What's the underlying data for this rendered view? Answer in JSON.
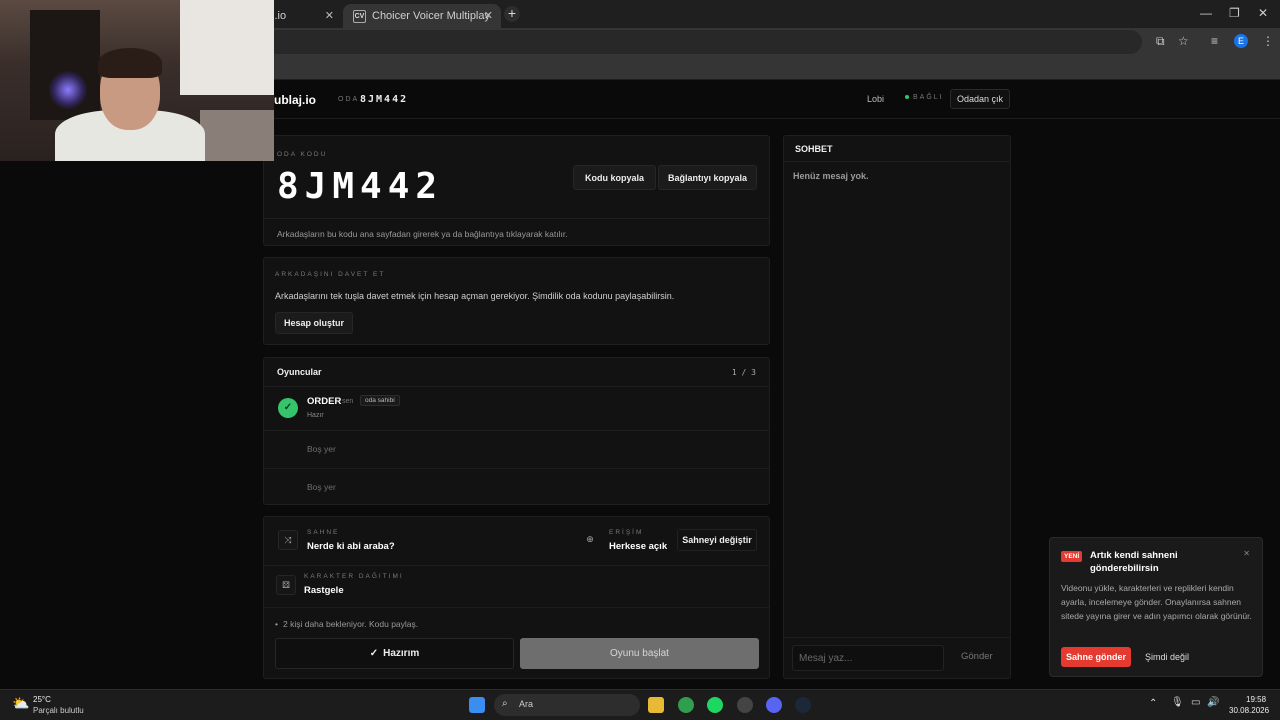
{
  "browser": {
    "tabs": [
      {
        "title": "i.io",
        "active": false
      },
      {
        "title": "Choicer Voicer Multiplayer – Pla",
        "active": true,
        "favicon": "CV"
      }
    ],
    "new_tab_icon": "plus-icon",
    "window_controls": [
      "minimize-icon",
      "restore-icon",
      "close-icon"
    ],
    "profile_initial": "E"
  },
  "header": {
    "logo": "ublaj.io",
    "room_label": "ODA",
    "room_code": "8JM442",
    "nav_lobby": "Lobi",
    "status": "BAĞLI",
    "leave_button": "Odadan çık"
  },
  "room_card": {
    "label": "ODA KODU",
    "code": "8JM442",
    "copy_code_button": "Kodu kopyala",
    "copy_link_button": "Bağlantıyı kopyala",
    "hint": "Arkadaşların bu kodu ana sayfadan girerek ya da bağlantıya tıklayarak katılır."
  },
  "invite_card": {
    "label": "ARKADAŞINI DAVET ET",
    "text": "Arkadaşlarını tek tuşla davet etmek için hesap açman gerekiyor. Şimdilik oda kodunu paylaşabilirsin.",
    "button": "Hesap oluştur"
  },
  "players": {
    "title": "Oyuncular",
    "count": "1 / 3",
    "list": [
      {
        "name": "ORDER",
        "you": "sen",
        "badge": "oda sahibi",
        "status": "Hazır"
      },
      {
        "empty": "Boş yer"
      },
      {
        "empty": "Boş yer"
      }
    ]
  },
  "settings": {
    "scene_label": "SAHNE",
    "scene_value": "Nerde ki abi araba?",
    "access_label": "ERİŞİM",
    "access_value": "Herkese açık",
    "change_scene_button": "Sahneyi değiştir",
    "character_label": "KARAKTER DAĞITIMI",
    "character_value": "Rastgele",
    "waiting_text": "2 kişi daha bekleniyor. Kodu paylaş.",
    "ready_button": "Hazırım",
    "start_button": "Oyunu başlat"
  },
  "chat": {
    "title": "SOHBET",
    "empty": "Henüz mesaj yok.",
    "placeholder": "Mesaj yaz...",
    "send_button": "Gönder"
  },
  "toast": {
    "badge": "YENİ",
    "title": "Artık kendi sahneni gönderebilirsin",
    "body": "Videonu yükle, karakterleri ve replikleri kendin ayarla, incelemeye gönder. Onaylanırsa sahnen sitede yayına girer ve adın yapımcı olarak görünür.",
    "primary": "Sahne gönder",
    "secondary": "Şimdi değil"
  },
  "taskbar": {
    "weather_temp": "25°C",
    "weather_desc": "Parçalı bulutlu",
    "search_placeholder": "Ara",
    "time": "19:58",
    "date": "30.08.2026"
  },
  "colors": {
    "accent_green": "#35c46b",
    "accent_red": "#e53a2f",
    "background": "#0a0a0a"
  }
}
